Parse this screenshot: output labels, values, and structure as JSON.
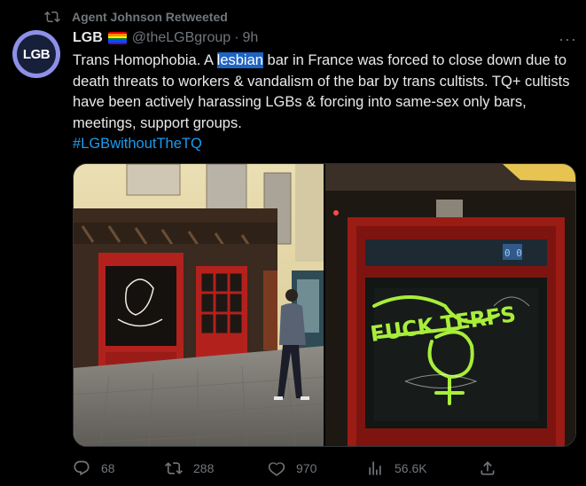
{
  "retweet": {
    "label": "Agent Johnson Retweeted"
  },
  "author": {
    "avatar_text": "LGB",
    "name": "LGB",
    "handle": "@theLGBgroup",
    "separator": "·",
    "time": "9h"
  },
  "tweet": {
    "text_part1": "Trans Homophobia. A ",
    "highlight": "lesbian",
    "text_part2": " bar in France was forced to close down due to death threats to workers & vandalism of the bar by trans cultists. TQ+ cultists have been actively harassing LGBs & forcing into same-sex only bars, meetings, support groups.",
    "hashtag": "#LGBwithoutTheTQ"
  },
  "media": {
    "photos": [
      {
        "icon": "photo-storefront-exterior"
      },
      {
        "icon": "photo-vandalized-door",
        "graffiti_text": "FUCK TERFS"
      }
    ]
  },
  "actions": {
    "replies": "68",
    "retweets": "288",
    "likes": "970",
    "views": "56.6K"
  },
  "colors": {
    "background": "#000000",
    "text": "#e7e9ea",
    "muted": "#71767b",
    "link": "#1d9bf0",
    "highlight": "#1d64c4",
    "avatar_ring": "#8e90e8",
    "graffiti": "#a8ee3a"
  }
}
